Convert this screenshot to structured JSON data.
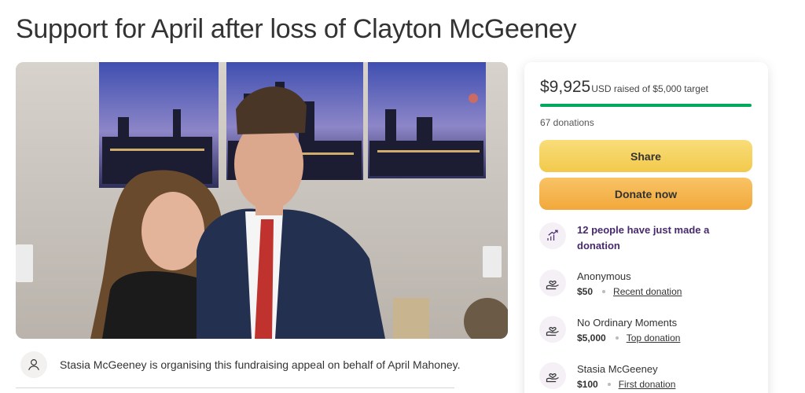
{
  "page": {
    "title": "Support for April after loss of Clayton McGeeney"
  },
  "organiser": {
    "icon": "person-icon",
    "text": "Stasia McGeeney is organising this fundraising appeal on behalf of April Mahoney."
  },
  "donation_card": {
    "amount_raised": "$9,925",
    "raised_label": "USD raised of $5,000 target",
    "progress_fraction": 1.0,
    "progress_color": "#02a95c",
    "donation_count": "67 donations",
    "share_label": "Share",
    "donate_label": "Donate now",
    "trend": {
      "icon": "trend-chart-icon",
      "text": "12 people have just made a donation"
    },
    "donations": [
      {
        "icon": "heart-hand-icon",
        "name": "Anonymous",
        "amount": "$50",
        "tag": "Recent donation"
      },
      {
        "icon": "heart-hand-icon",
        "name": "No Ordinary Moments",
        "amount": "$5,000",
        "tag": "Top donation"
      },
      {
        "icon": "heart-hand-icon",
        "name": "Stasia McGeeney",
        "amount": "$100",
        "tag": "First donation"
      }
    ]
  }
}
